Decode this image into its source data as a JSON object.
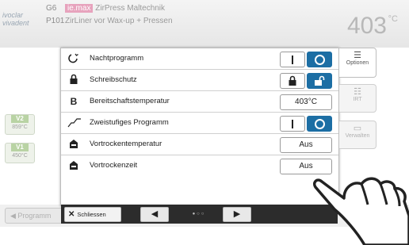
{
  "header": {
    "brand": "ivoclar vivadent",
    "program_code_1": "G6",
    "program_code_2": "P101",
    "badge": "ie.max",
    "title_line1": "ZirPress Maltechnik",
    "title_line2": "ZirLiner vor Wax-up + Pressen",
    "temperature": "403",
    "temperature_unit": "°C"
  },
  "left_pills": [
    {
      "label": "V2",
      "value": "859°C"
    },
    {
      "label": "V1",
      "value": "450°C"
    }
  ],
  "program_button": "Programm",
  "options_panel": {
    "rows": [
      {
        "icon": "night-icon",
        "label": "Nachtprogramm",
        "control": "toggle",
        "state": "on"
      },
      {
        "icon": "lock-icon",
        "label": "Schreibschutz",
        "control": "lock-toggle",
        "state": "unlocked"
      },
      {
        "icon": "b-icon",
        "label": "Bereitschaftstemperatur",
        "value": "403°C"
      },
      {
        "icon": "two-stage-icon",
        "label": "Zweistufiges Programm",
        "control": "toggle",
        "state": "on"
      },
      {
        "icon": "predry-temp-icon",
        "label": "Vortrockentemperatur",
        "value": "Aus"
      },
      {
        "icon": "predry-time-icon",
        "label": "Vortrockenzeit",
        "value": "Aus"
      }
    ]
  },
  "side_tabs": [
    {
      "label": "Optionen",
      "icon": "options-icon",
      "active": true
    },
    {
      "label": "IRT",
      "icon": "irt-icon",
      "active": false
    },
    {
      "label": "Verwalten",
      "icon": "manage-icon",
      "active": false
    }
  ],
  "footer": {
    "close_label": "Schliessen",
    "page_dots": "●○○"
  },
  "colors": {
    "accent_blue": "#1c6ea4",
    "badge_pink": "#e7a3bd",
    "footer_dark": "#2c2c2c"
  }
}
